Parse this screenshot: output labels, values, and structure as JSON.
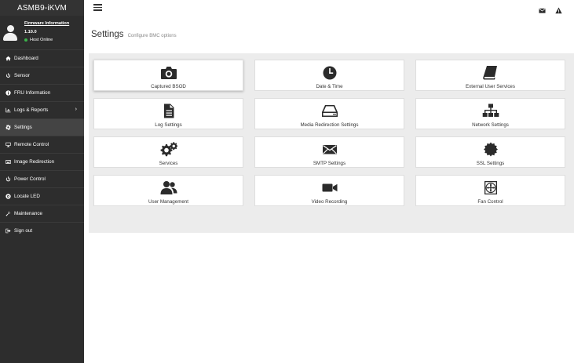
{
  "brand": "ASMB9-iKVM",
  "profile": {
    "firmware_link": "Firmware Information",
    "firmware_version": "1.10.0",
    "host_status": "Host Online",
    "status_color": "#3cb44b"
  },
  "sidebar": {
    "items": [
      {
        "label": "Dashboard",
        "icon": "dashboard-icon"
      },
      {
        "label": "Sensor",
        "icon": "sensor-icon"
      },
      {
        "label": "FRU Information",
        "icon": "info-icon"
      },
      {
        "label": "Logs & Reports",
        "icon": "chart-icon",
        "has_submenu": true
      },
      {
        "label": "Settings",
        "icon": "gear-icon",
        "active": true
      },
      {
        "label": "Remote Control",
        "icon": "monitor-icon"
      },
      {
        "label": "Image Redirection",
        "icon": "image-icon"
      },
      {
        "label": "Power Control",
        "icon": "power-icon"
      },
      {
        "label": "Locate LED",
        "icon": "locate-icon"
      },
      {
        "label": "Maintenance",
        "icon": "wrench-icon"
      },
      {
        "label": "Sign out",
        "icon": "sign-out-icon"
      }
    ],
    "chevron": "›"
  },
  "topbar": {
    "icons": [
      "menu-icon",
      "mail-icon",
      "warning-icon"
    ]
  },
  "main": {
    "title": "Settings",
    "subtitle": "Configure BMC options",
    "tiles": [
      {
        "label": "Captured BSOD",
        "icon": "camera-icon"
      },
      {
        "label": "Date & Time",
        "icon": "clock-icon"
      },
      {
        "label": "External User Services",
        "icon": "book-icon"
      },
      {
        "label": "Log Settings",
        "icon": "document-icon"
      },
      {
        "label": "Media Redirection Settings",
        "icon": "hdd-icon"
      },
      {
        "label": "Network Settings",
        "icon": "sitemap-icon"
      },
      {
        "label": "Services",
        "icon": "gears-icon"
      },
      {
        "label": "SMTP Settings",
        "icon": "envelope-icon"
      },
      {
        "label": "SSL Settings",
        "icon": "certificate-icon"
      },
      {
        "label": "User Management",
        "icon": "users-icon"
      },
      {
        "label": "Video Recording",
        "icon": "video-camera-icon"
      },
      {
        "label": "Fan Control",
        "icon": "fan-icon"
      }
    ]
  }
}
